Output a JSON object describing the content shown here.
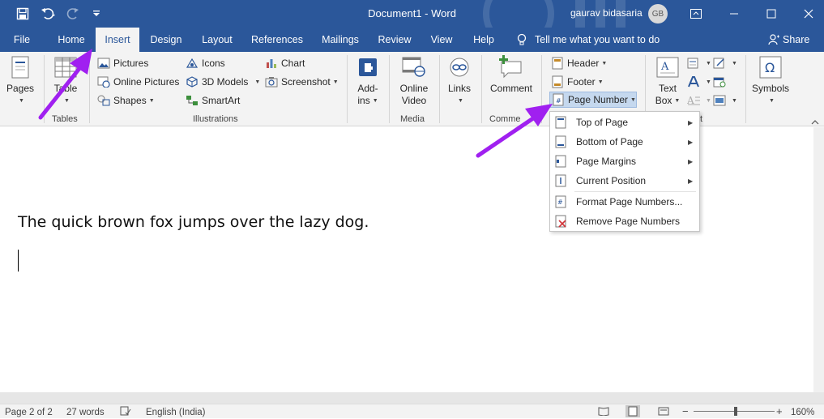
{
  "window": {
    "title": "Document1 - Word",
    "user": "gaurav bidasaria",
    "avatar_initials": "GB",
    "accent": "#2b579a"
  },
  "quick_access": {
    "icons": [
      "save-icon",
      "undo-icon",
      "redo-icon",
      "customize-icon"
    ]
  },
  "tabs": [
    {
      "label": "File"
    },
    {
      "label": "Home"
    },
    {
      "label": "Insert",
      "active": true
    },
    {
      "label": "Design"
    },
    {
      "label": "Layout"
    },
    {
      "label": "References"
    },
    {
      "label": "Mailings"
    },
    {
      "label": "Review"
    },
    {
      "label": "View"
    },
    {
      "label": "Help"
    }
  ],
  "tell_me": "Tell me what you want to do",
  "share": "Share",
  "ribbon": {
    "pages": "Pages",
    "table": "Table",
    "tables_group": "Tables",
    "pictures": "Pictures",
    "online_pictures": "Online Pictures",
    "shapes": "Shapes",
    "icons": "Icons",
    "models_3d": "3D Models",
    "smartart": "SmartArt",
    "chart": "Chart",
    "screenshot": "Screenshot",
    "illustrations_group": "Illustrations",
    "addins_1": "Add-",
    "addins_2": "ins",
    "online_video_1": "Online",
    "online_video_2": "Video",
    "media_group": "Media",
    "links": "Links",
    "comment": "Comment",
    "comments_group": "Comme",
    "header": "Header",
    "footer": "Footer",
    "page_number": "Page Number",
    "text_box_1": "Text",
    "text_box_2": "Box",
    "text_group": "t",
    "symbols": "Symbols"
  },
  "page_number_menu": [
    {
      "label": "Top of Page",
      "submenu": true
    },
    {
      "label": "Bottom of Page",
      "submenu": true
    },
    {
      "label": "Page Margins",
      "submenu": true
    },
    {
      "label": "Current Position",
      "submenu": true
    },
    {
      "label": "Format Page Numbers...",
      "submenu": false
    },
    {
      "label": "Remove Page Numbers",
      "submenu": false
    }
  ],
  "document": {
    "text": "The quick brown fox jumps over the lazy dog."
  },
  "status": {
    "page": "Page 2 of 2",
    "words": "27 words",
    "language": "English (India)",
    "zoom": "160%"
  },
  "annotation_color": "#a020f0"
}
